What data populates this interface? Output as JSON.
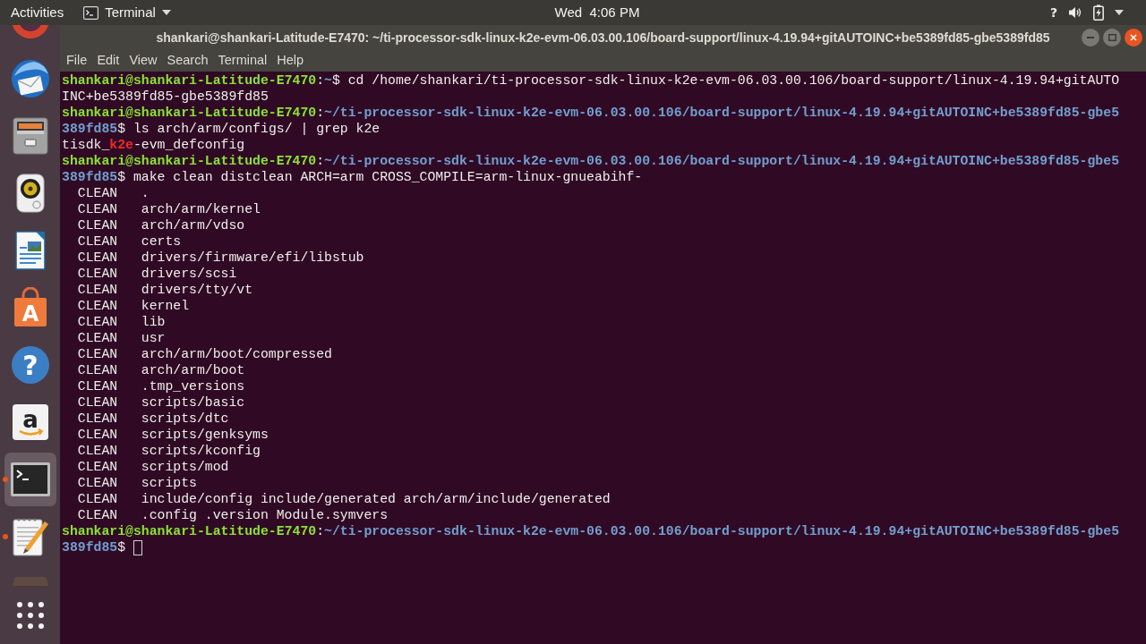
{
  "top_bar": {
    "activities": "Activities",
    "app_menu": "Terminal",
    "clock": "Wed  4:06 PM",
    "network_glyph": "?"
  },
  "dock": {
    "items": [
      {
        "kind": "browser",
        "selected": false,
        "running": false
      },
      {
        "kind": "mail",
        "selected": false,
        "running": false
      },
      {
        "kind": "files",
        "selected": false,
        "running": false
      },
      {
        "kind": "music",
        "selected": false,
        "running": false
      },
      {
        "kind": "writer",
        "selected": false,
        "running": false
      },
      {
        "kind": "software",
        "glyph": "A",
        "selected": false,
        "running": false
      },
      {
        "kind": "help",
        "glyph": "?",
        "selected": false,
        "running": false
      },
      {
        "kind": "amazon",
        "glyph": "a",
        "selected": false,
        "running": false
      },
      {
        "kind": "terminal",
        "selected": true,
        "running": true
      },
      {
        "kind": "editor",
        "selected": false,
        "running": true
      },
      {
        "kind": "faded",
        "selected": false,
        "running": false
      }
    ]
  },
  "window": {
    "title": "shankari@shankari-Latitude-E7470: ~/ti-processor-sdk-linux-k2e-evm-06.03.00.106/board-support/linux-4.19.94+gitAUTOINC+be5389fd85-gbe5389fd85",
    "menu": [
      "File",
      "Edit",
      "View",
      "Search",
      "Terminal",
      "Help"
    ],
    "terminal": {
      "cursor_filled": false,
      "lines": [
        {
          "kind": "shell",
          "segments": [
            {
              "kind": "user",
              "text": "shankari@shankari-Latitude-E7470"
            },
            {
              "kind": "text",
              "text": ":"
            },
            {
              "kind": "path",
              "text": "~"
            },
            {
              "kind": "text",
              "text": "$ cd /home/shankari/ti-processor-sdk-linux-k2e-evm-06.03.00.106/board-support/linux-4.19.94+gitAUTO"
            }
          ]
        },
        {
          "kind": "shell",
          "segments": [
            {
              "kind": "text",
              "text": "INC+be5389fd85-gbe5389fd85"
            }
          ]
        },
        {
          "kind": "shell",
          "segments": [
            {
              "kind": "user",
              "text": "shankari@shankari-Latitude-E7470"
            },
            {
              "kind": "text",
              "text": ":"
            },
            {
              "kind": "path",
              "text": "~/ti-processor-sdk-linux-k2e-evm-06.03.00.106/board-support/linux-4.19.94+gitAUTOINC+be5389fd85-gbe5"
            }
          ]
        },
        {
          "kind": "shell",
          "segments": [
            {
              "kind": "path",
              "text": "389fd85"
            },
            {
              "kind": "text",
              "text": "$ ls arch/arm/configs/ | grep k2e"
            }
          ]
        },
        {
          "kind": "shell",
          "segments": [
            {
              "kind": "text",
              "text": "tisdk_"
            },
            {
              "kind": "match",
              "text": "k2e"
            },
            {
              "kind": "text",
              "text": "-evm_defconfig"
            }
          ]
        },
        {
          "kind": "shell",
          "segments": [
            {
              "kind": "user",
              "text": "shankari@shankari-Latitude-E7470"
            },
            {
              "kind": "text",
              "text": ":"
            },
            {
              "kind": "path",
              "text": "~/ti-processor-sdk-linux-k2e-evm-06.03.00.106/board-support/linux-4.19.94+gitAUTOINC+be5389fd85-gbe5"
            }
          ]
        },
        {
          "kind": "shell",
          "segments": [
            {
              "kind": "path",
              "text": "389fd85"
            },
            {
              "kind": "text",
              "text": "$ make clean distclean ARCH=arm CROSS_COMPILE=arm-linux-gnueabihf-"
            }
          ]
        },
        {
          "kind": "build",
          "text": "CLEAN   ."
        },
        {
          "kind": "build",
          "text": "CLEAN   arch/arm/kernel"
        },
        {
          "kind": "build",
          "text": "CLEAN   arch/arm/vdso"
        },
        {
          "kind": "build",
          "text": "CLEAN   certs"
        },
        {
          "kind": "build",
          "text": "CLEAN   drivers/firmware/efi/libstub"
        },
        {
          "kind": "build",
          "text": "CLEAN   drivers/scsi"
        },
        {
          "kind": "build",
          "text": "CLEAN   drivers/tty/vt"
        },
        {
          "kind": "build",
          "text": "CLEAN   kernel"
        },
        {
          "kind": "build",
          "text": "CLEAN   lib"
        },
        {
          "kind": "build",
          "text": "CLEAN   usr"
        },
        {
          "kind": "build",
          "text": "CLEAN   arch/arm/boot/compressed"
        },
        {
          "kind": "build",
          "text": "CLEAN   arch/arm/boot"
        },
        {
          "kind": "build",
          "text": "CLEAN   .tmp_versions"
        },
        {
          "kind": "build",
          "text": "CLEAN   scripts/basic"
        },
        {
          "kind": "build",
          "text": "CLEAN   scripts/dtc"
        },
        {
          "kind": "build",
          "text": "CLEAN   scripts/genksyms"
        },
        {
          "kind": "build",
          "text": "CLEAN   scripts/kconfig"
        },
        {
          "kind": "build",
          "text": "CLEAN   scripts/mod"
        },
        {
          "kind": "build",
          "text": "CLEAN   scripts"
        },
        {
          "kind": "build",
          "text": "CLEAN   include/config include/generated arch/arm/include/generated"
        },
        {
          "kind": "build",
          "text": "CLEAN   .config .version Module.symvers"
        },
        {
          "kind": "shell",
          "segments": [
            {
              "kind": "user",
              "text": "shankari@shankari-Latitude-E7470"
            },
            {
              "kind": "text",
              "text": ":"
            },
            {
              "kind": "path",
              "text": "~/ti-processor-sdk-linux-k2e-evm-06.03.00.106/board-support/linux-4.19.94+gitAUTOINC+be5389fd85-gbe5"
            }
          ]
        },
        {
          "kind": "shell",
          "segments": [
            {
              "kind": "path",
              "text": "389fd85"
            },
            {
              "kind": "text",
              "text": "$"
            }
          ]
        }
      ]
    }
  }
}
